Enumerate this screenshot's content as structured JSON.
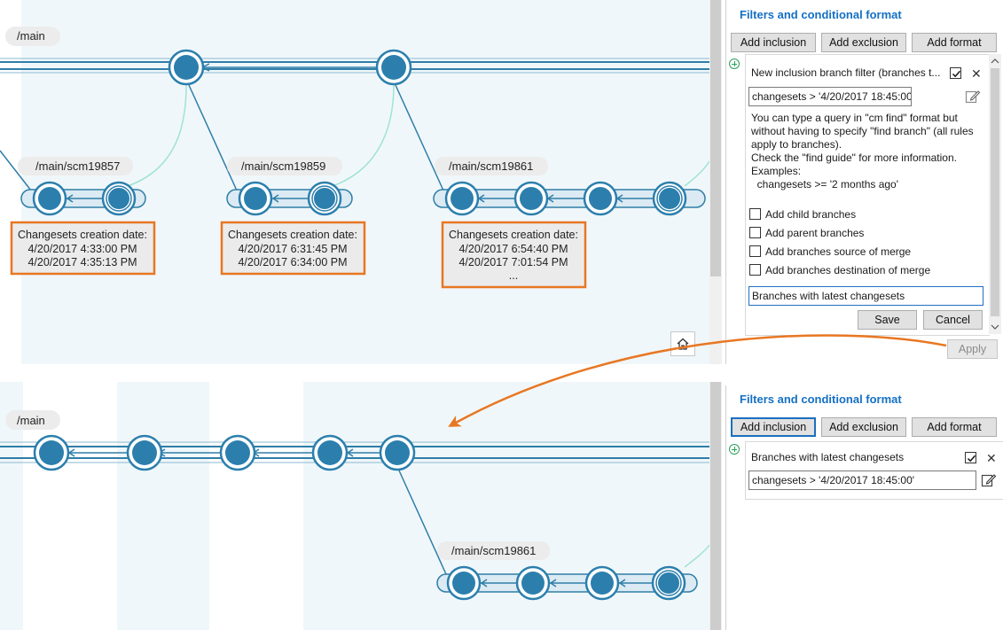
{
  "top_graph": {
    "main_branch_label": "/main",
    "child_branches": [
      {
        "label": "/main/scm19857",
        "tooltip_title": "Changesets creation date:",
        "tooltip_lines": [
          "4/20/2017 4:33:00 PM",
          "4/20/2017 4:35:13 PM"
        ]
      },
      {
        "label": "/main/scm19859",
        "tooltip_title": "Changesets creation date:",
        "tooltip_lines": [
          "4/20/2017 6:31:45 PM",
          "4/20/2017 6:34:00 PM"
        ]
      },
      {
        "label": "/main/scm19861",
        "tooltip_title": "Changesets creation date:",
        "tooltip_lines": [
          "4/20/2017 6:54:40 PM",
          "4/20/2017 7:01:54 PM",
          "..."
        ]
      }
    ]
  },
  "bottom_graph": {
    "main_branch_label": "/main",
    "child_branch_label": "/main/scm19861"
  },
  "top_panel": {
    "title": "Filters and conditional format",
    "buttons": {
      "add_inclusion": "Add inclusion",
      "add_exclusion": "Add exclusion",
      "add_format": "Add format"
    },
    "filter": {
      "title": "New inclusion branch filter (branches t...",
      "checked": true,
      "query": "changesets > '4/20/2017 18:45:00'",
      "help": "You can type a query in \"cm find\" format but\nwithout having to specify \"find branch\" (all rules\napply to branches).\nCheck the \"find guide\" for more information.\nExamples:\n  changesets >= '2 months ago'",
      "options": [
        "Add child branches",
        "Add parent branches",
        "Add branches source of merge",
        "Add branches destination of merge"
      ],
      "name_value": "Branches with latest changesets",
      "save": "Save",
      "cancel": "Cancel"
    },
    "apply": "Apply"
  },
  "bottom_panel": {
    "title": "Filters and conditional format",
    "buttons": {
      "add_inclusion": "Add inclusion",
      "add_exclusion": "Add exclusion",
      "add_format": "Add format"
    },
    "filter": {
      "title": "Branches with latest changesets",
      "checked": true,
      "query": "changesets > '4/20/2017 18:45:00'"
    }
  },
  "colors": {
    "node": "#2c7fad",
    "branch_line": "#2f7ea8",
    "highlight": "#e87722",
    "link": "#1570c4",
    "bg_band": "#f0f7fa"
  },
  "icons": [
    "home-icon",
    "plus-circle-icon",
    "checkbox-icon",
    "close-icon",
    "edit-icon",
    "arrow-icon"
  ]
}
